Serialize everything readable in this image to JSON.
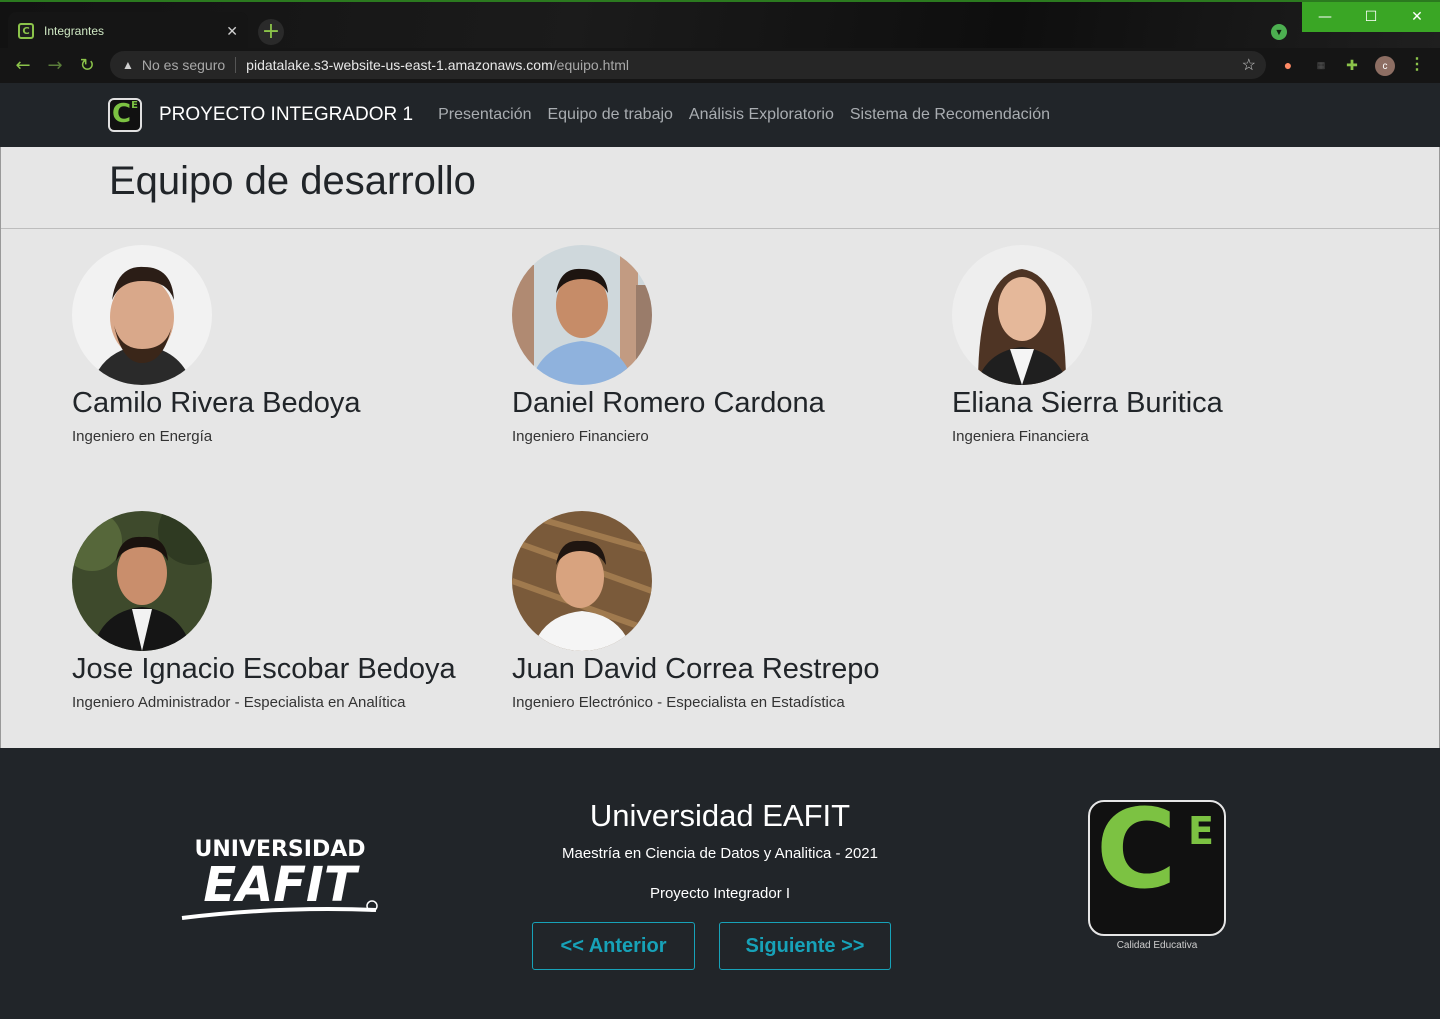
{
  "browser": {
    "tab_title": "Integrantes",
    "tab_close": "✕",
    "new_tab": "+",
    "not_secure": "No es seguro",
    "url_host": "pidatalake.s3-website-us-east-1.amazonaws.com",
    "url_path": "/equipo.html",
    "profile_initial": "c",
    "win_minimize": "—",
    "win_maximize": "☐",
    "win_close": "✕",
    "accent_color": "#8bc34a"
  },
  "navbar": {
    "brand": "PROYECTO INTEGRADOR 1",
    "links": [
      "Presentación",
      "Equipo de trabajo",
      "Análisis Exploratorio",
      "Sistema de Recomendación"
    ]
  },
  "page": {
    "title": "Equipo de desarrollo"
  },
  "members": [
    {
      "name": "Camilo Rivera Bedoya",
      "role": "Ingeniero en Energía"
    },
    {
      "name": "Daniel Romero Cardona",
      "role": "Ingeniero Financiero"
    },
    {
      "name": "Eliana Sierra Buritica",
      "role": "Ingeniera Financiera"
    },
    {
      "name": "Jose Ignacio Escobar Bedoya",
      "role": "Ingeniero Administrador - Especialista en Analítica"
    },
    {
      "name": "Juan David Correa Restrepo",
      "role": "Ingeniero Electrónico - Especialista en Estadística"
    }
  ],
  "footer": {
    "logo_text_top": "UNIVERSIDAD",
    "logo_text_main": "EAFIT",
    "title": "Universidad EAFIT",
    "subtitle": "Maestría en Ciencia de Datos y Analitica - 2021",
    "course": "Proyecto Integrador I",
    "prev_label": "<< Anterior",
    "next_label": "Siguiente >>",
    "ce_caption": "Calidad Educativa",
    "button_color": "#17a2b8"
  }
}
